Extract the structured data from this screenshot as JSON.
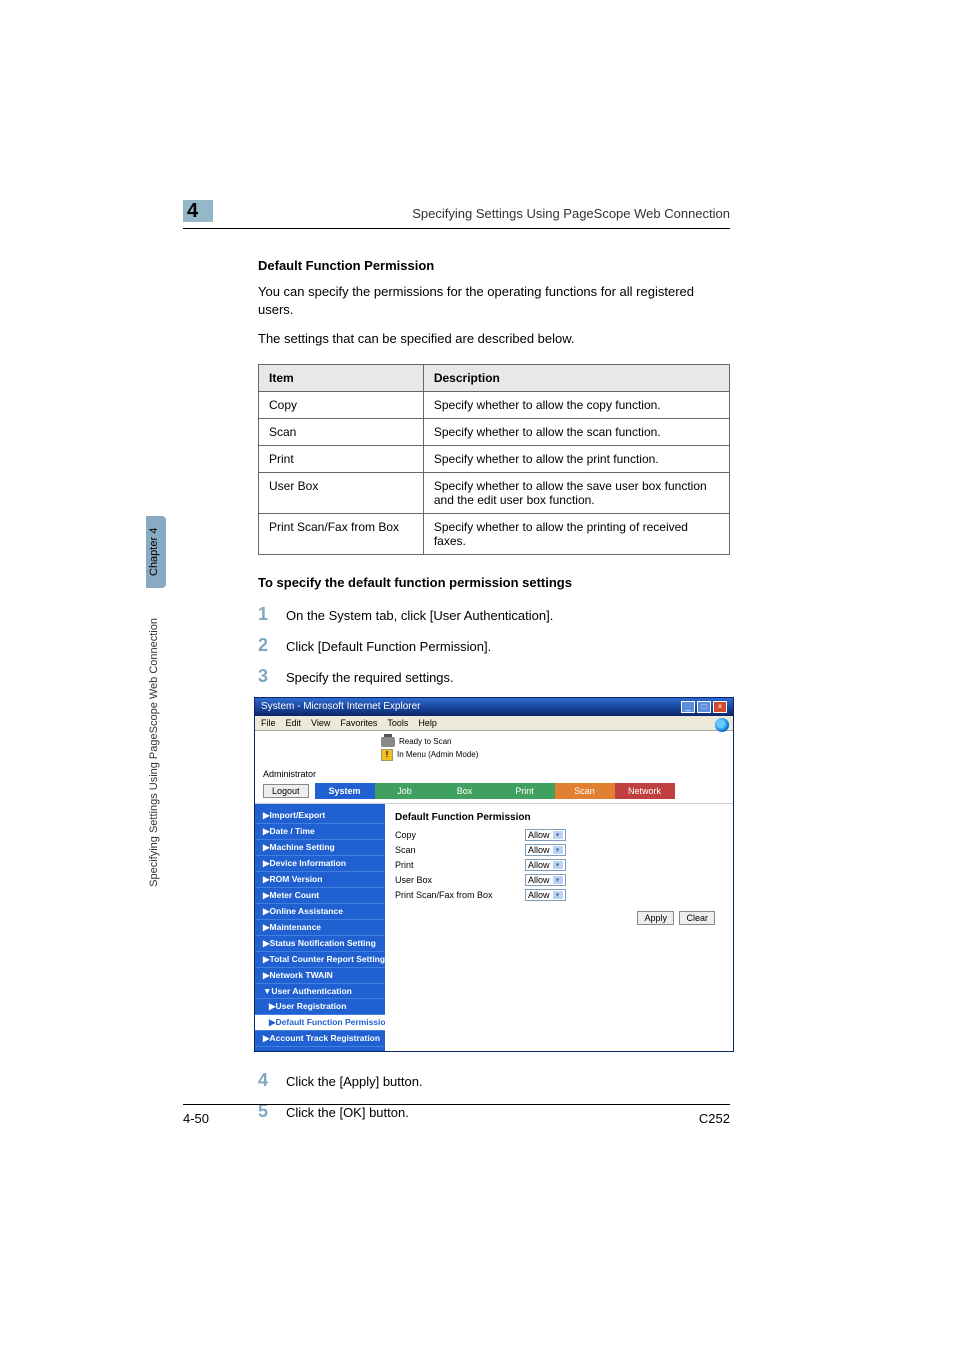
{
  "chapter_num": "4",
  "running_head": "Specifying Settings Using PageScope Web Connection",
  "section_title": "Default Function Permission",
  "intro_para": "You can specify the permissions for the operating functions for all registered users.",
  "settings_para": "The settings that can be specified are described below.",
  "table": {
    "head_item": "Item",
    "head_desc": "Description",
    "rows": [
      {
        "item": "Copy",
        "desc": "Specify whether to allow the copy function."
      },
      {
        "item": "Scan",
        "desc": "Specify whether to allow the scan function."
      },
      {
        "item": "Print",
        "desc": "Specify whether to allow the print function."
      },
      {
        "item": "User Box",
        "desc": "Specify whether to allow the save user box function and the edit user box function."
      },
      {
        "item": "Print Scan/Fax from Box",
        "desc": "Specify whether to allow the printing of received faxes."
      }
    ]
  },
  "subsection": "To specify the default function permission settings",
  "steps": {
    "s1": {
      "num": "1",
      "text": "On the System tab, click [User Authentication]."
    },
    "s2": {
      "num": "2",
      "text": "Click [Default Function Permission]."
    },
    "s3": {
      "num": "3",
      "text": "Specify the required settings."
    },
    "s4": {
      "num": "4",
      "text": "Click the [Apply] button."
    },
    "s5": {
      "num": "5",
      "text": "Click the [OK] button."
    }
  },
  "browser": {
    "title": "System - Microsoft Internet Explorer",
    "menu": {
      "file": "File",
      "edit": "Edit",
      "view": "View",
      "favorites": "Favorites",
      "tools": "Tools",
      "help": "Help"
    },
    "ready": "Ready to Scan",
    "menus_mode": "In Menu (Admin Mode)",
    "admin": "Administrator",
    "logout": "Logout",
    "tabs": {
      "system": "System",
      "job": "Job",
      "box": "Box",
      "print": "Print",
      "scan": "Scan",
      "network": "Network"
    },
    "sidebar": [
      "▶Import/Export",
      "▶Date / Time",
      "▶Machine Setting",
      "▶Device Information",
      "▶ROM Version",
      "▶Meter Count",
      "▶Online Assistance",
      "▶Maintenance",
      "▶Status Notification Setting",
      "▶Total Counter Report Setting",
      "▶Network TWAIN",
      "▼User Authentication",
      "▶User Registration",
      "▶Default Function Permission",
      "▶Account Track Registration"
    ],
    "active_index": 13,
    "indent_indexes": [
      12,
      13
    ],
    "panel_title": "Default Function Permission",
    "form_rows": [
      {
        "label": "Copy",
        "value": "Allow"
      },
      {
        "label": "Scan",
        "value": "Allow"
      },
      {
        "label": "Print",
        "value": "Allow"
      },
      {
        "label": "User Box",
        "value": "Allow"
      },
      {
        "label": "Print Scan/Fax from Box",
        "value": "Allow"
      }
    ],
    "apply": "Apply",
    "clear": "Clear"
  },
  "side_tab": "Chapter 4",
  "side_label": "Specifying Settings Using PageScope Web Connection",
  "footer": {
    "left": "4-50",
    "right": "C252"
  }
}
